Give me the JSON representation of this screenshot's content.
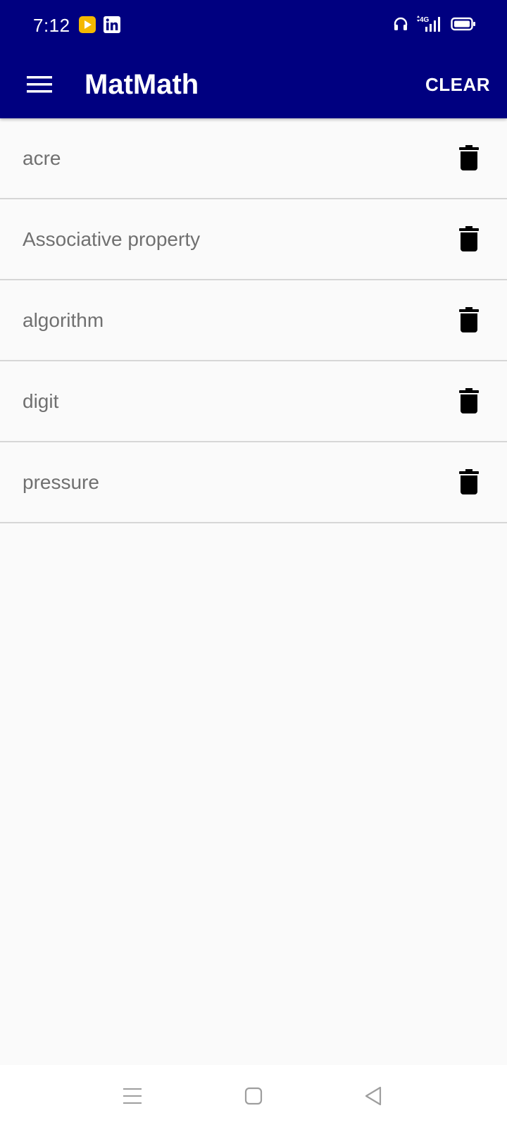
{
  "status_bar": {
    "time": "7:12",
    "notifications": [
      "play-store-icon",
      "linkedin-icon"
    ],
    "indicators": [
      "headset-icon",
      "signal-4g-icon",
      "battery-icon"
    ],
    "network_label": "4G"
  },
  "toolbar": {
    "menu_icon": "hamburger-menu-icon",
    "title": "MatMath",
    "clear_label": "CLEAR",
    "background_color": "#000080"
  },
  "history": {
    "items": [
      {
        "label": "acre"
      },
      {
        "label": "Associative property"
      },
      {
        "label": "algorithm"
      },
      {
        "label": "digit"
      },
      {
        "label": "pressure"
      }
    ],
    "delete_icon": "trash-icon"
  },
  "nav_bar": {
    "buttons": [
      "recent-apps-icon",
      "home-icon",
      "back-icon"
    ]
  }
}
